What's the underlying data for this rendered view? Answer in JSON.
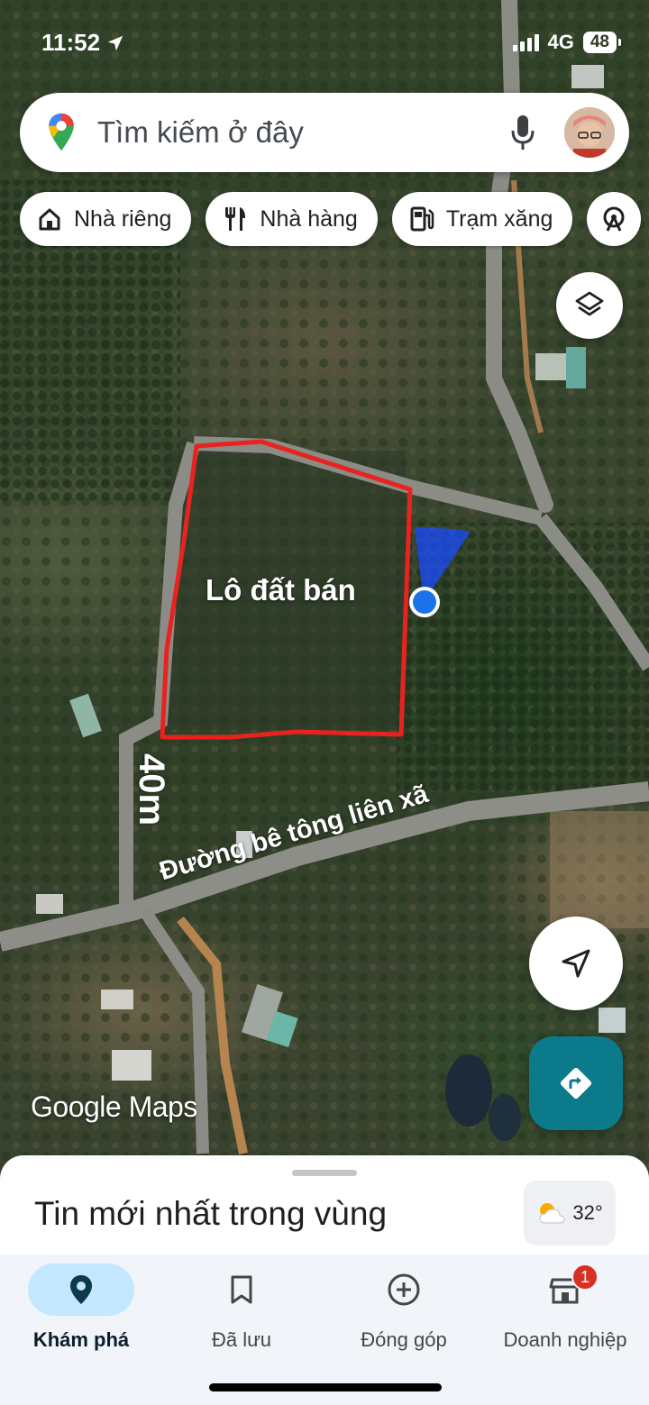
{
  "status_bar": {
    "time": "11:52",
    "network": "4G",
    "battery": "48"
  },
  "search": {
    "placeholder": "Tìm kiếm ở đây"
  },
  "chips": [
    {
      "label": "Nhà riêng",
      "icon": "home-icon"
    },
    {
      "label": "Nhà hàng",
      "icon": "restaurant-icon"
    },
    {
      "label": "Trạm xăng",
      "icon": "gas-station-icon"
    },
    {
      "label": "",
      "icon": "attraction-icon"
    }
  ],
  "map": {
    "annotations": {
      "lot_label": "Lô đất bán",
      "width_label": "40m",
      "road_label": "Đường bê tông liên xã"
    },
    "outline_color": "#e8231f",
    "watermark": "Google Maps"
  },
  "sheet": {
    "title": "Tin mới nhất trong vùng",
    "weather": "32°"
  },
  "nav": {
    "items": [
      {
        "label": "Khám phá",
        "icon": "explore-pin-icon",
        "active": true
      },
      {
        "label": "Đã lưu",
        "icon": "bookmark-icon",
        "active": false
      },
      {
        "label": "Đóng góp",
        "icon": "add-circle-icon",
        "active": false
      },
      {
        "label": "Doanh nghiệp",
        "icon": "business-icon",
        "active": false,
        "badge": "1"
      }
    ]
  },
  "colors": {
    "accent": "#0b7a8a",
    "nav_active": "#c2e7ff",
    "location_dot": "#1a73e8"
  }
}
